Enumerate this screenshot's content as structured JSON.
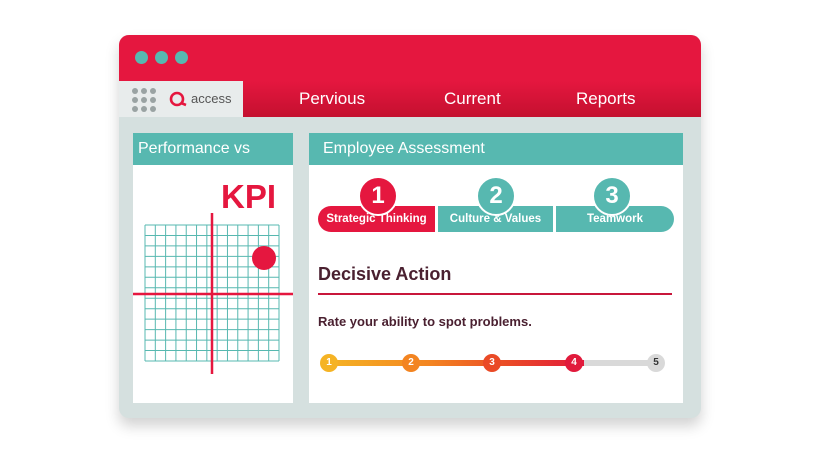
{
  "window": {
    "logo_text": "access",
    "nav": [
      "Pervious",
      "Current",
      "Reports"
    ]
  },
  "left_panel": {
    "title": "Performance vs Goals",
    "kpi_label": "KPI"
  },
  "right_panel": {
    "title": "Employee Assessment",
    "steps": [
      {
        "number": "1",
        "label": "Strategic Thinking",
        "state": "active"
      },
      {
        "number": "2",
        "label": "Culture & Values",
        "state": "inactive"
      },
      {
        "number": "3",
        "label": "Teamwork",
        "state": "inactive"
      }
    ],
    "section_title": "Decisive Action",
    "question": "Rate your ability to spot problems.",
    "rating": {
      "options": [
        "1",
        "2",
        "3",
        "4",
        "5"
      ],
      "selected": 4
    }
  },
  "colors": {
    "brand_red": "#e5173f",
    "teal": "#57b8b0",
    "rating_yellow": "#f5b324",
    "rating_orange": "#f38421",
    "rating_redorange": "#ea4a26",
    "rating_red": "#e11a3c",
    "rating_inactive": "#d9d9d9"
  },
  "icons": [
    "apps-grid-icon",
    "access-logo-icon"
  ]
}
